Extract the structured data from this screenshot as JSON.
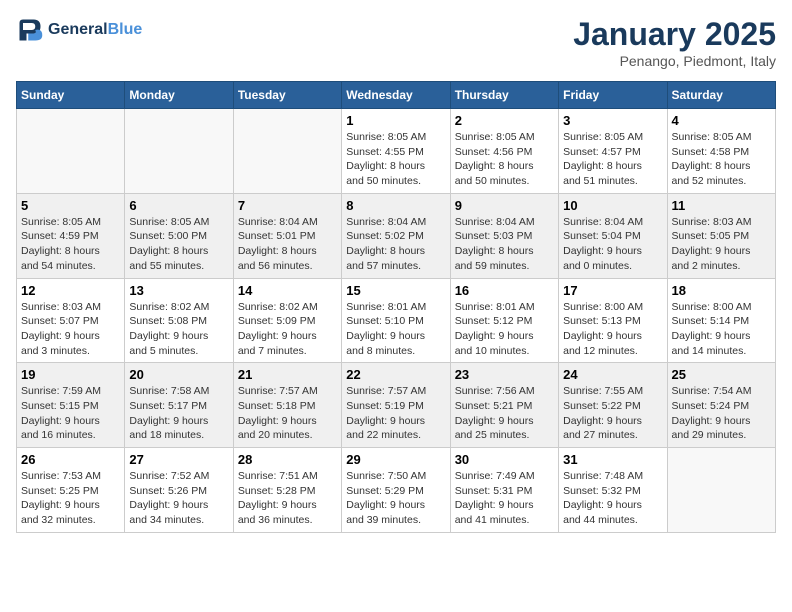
{
  "header": {
    "logo_line1": "General",
    "logo_line2": "Blue",
    "month": "January 2025",
    "location": "Penango, Piedmont, Italy"
  },
  "weekdays": [
    "Sunday",
    "Monday",
    "Tuesday",
    "Wednesday",
    "Thursday",
    "Friday",
    "Saturday"
  ],
  "rows": [
    [
      {
        "day": "",
        "info": ""
      },
      {
        "day": "",
        "info": ""
      },
      {
        "day": "",
        "info": ""
      },
      {
        "day": "1",
        "info": "Sunrise: 8:05 AM\nSunset: 4:55 PM\nDaylight: 8 hours\nand 50 minutes."
      },
      {
        "day": "2",
        "info": "Sunrise: 8:05 AM\nSunset: 4:56 PM\nDaylight: 8 hours\nand 50 minutes."
      },
      {
        "day": "3",
        "info": "Sunrise: 8:05 AM\nSunset: 4:57 PM\nDaylight: 8 hours\nand 51 minutes."
      },
      {
        "day": "4",
        "info": "Sunrise: 8:05 AM\nSunset: 4:58 PM\nDaylight: 8 hours\nand 52 minutes."
      }
    ],
    [
      {
        "day": "5",
        "info": "Sunrise: 8:05 AM\nSunset: 4:59 PM\nDaylight: 8 hours\nand 54 minutes."
      },
      {
        "day": "6",
        "info": "Sunrise: 8:05 AM\nSunset: 5:00 PM\nDaylight: 8 hours\nand 55 minutes."
      },
      {
        "day": "7",
        "info": "Sunrise: 8:04 AM\nSunset: 5:01 PM\nDaylight: 8 hours\nand 56 minutes."
      },
      {
        "day": "8",
        "info": "Sunrise: 8:04 AM\nSunset: 5:02 PM\nDaylight: 8 hours\nand 57 minutes."
      },
      {
        "day": "9",
        "info": "Sunrise: 8:04 AM\nSunset: 5:03 PM\nDaylight: 8 hours\nand 59 minutes."
      },
      {
        "day": "10",
        "info": "Sunrise: 8:04 AM\nSunset: 5:04 PM\nDaylight: 9 hours\nand 0 minutes."
      },
      {
        "day": "11",
        "info": "Sunrise: 8:03 AM\nSunset: 5:05 PM\nDaylight: 9 hours\nand 2 minutes."
      }
    ],
    [
      {
        "day": "12",
        "info": "Sunrise: 8:03 AM\nSunset: 5:07 PM\nDaylight: 9 hours\nand 3 minutes."
      },
      {
        "day": "13",
        "info": "Sunrise: 8:02 AM\nSunset: 5:08 PM\nDaylight: 9 hours\nand 5 minutes."
      },
      {
        "day": "14",
        "info": "Sunrise: 8:02 AM\nSunset: 5:09 PM\nDaylight: 9 hours\nand 7 minutes."
      },
      {
        "day": "15",
        "info": "Sunrise: 8:01 AM\nSunset: 5:10 PM\nDaylight: 9 hours\nand 8 minutes."
      },
      {
        "day": "16",
        "info": "Sunrise: 8:01 AM\nSunset: 5:12 PM\nDaylight: 9 hours\nand 10 minutes."
      },
      {
        "day": "17",
        "info": "Sunrise: 8:00 AM\nSunset: 5:13 PM\nDaylight: 9 hours\nand 12 minutes."
      },
      {
        "day": "18",
        "info": "Sunrise: 8:00 AM\nSunset: 5:14 PM\nDaylight: 9 hours\nand 14 minutes."
      }
    ],
    [
      {
        "day": "19",
        "info": "Sunrise: 7:59 AM\nSunset: 5:15 PM\nDaylight: 9 hours\nand 16 minutes."
      },
      {
        "day": "20",
        "info": "Sunrise: 7:58 AM\nSunset: 5:17 PM\nDaylight: 9 hours\nand 18 minutes."
      },
      {
        "day": "21",
        "info": "Sunrise: 7:57 AM\nSunset: 5:18 PM\nDaylight: 9 hours\nand 20 minutes."
      },
      {
        "day": "22",
        "info": "Sunrise: 7:57 AM\nSunset: 5:19 PM\nDaylight: 9 hours\nand 22 minutes."
      },
      {
        "day": "23",
        "info": "Sunrise: 7:56 AM\nSunset: 5:21 PM\nDaylight: 9 hours\nand 25 minutes."
      },
      {
        "day": "24",
        "info": "Sunrise: 7:55 AM\nSunset: 5:22 PM\nDaylight: 9 hours\nand 27 minutes."
      },
      {
        "day": "25",
        "info": "Sunrise: 7:54 AM\nSunset: 5:24 PM\nDaylight: 9 hours\nand 29 minutes."
      }
    ],
    [
      {
        "day": "26",
        "info": "Sunrise: 7:53 AM\nSunset: 5:25 PM\nDaylight: 9 hours\nand 32 minutes."
      },
      {
        "day": "27",
        "info": "Sunrise: 7:52 AM\nSunset: 5:26 PM\nDaylight: 9 hours\nand 34 minutes."
      },
      {
        "day": "28",
        "info": "Sunrise: 7:51 AM\nSunset: 5:28 PM\nDaylight: 9 hours\nand 36 minutes."
      },
      {
        "day": "29",
        "info": "Sunrise: 7:50 AM\nSunset: 5:29 PM\nDaylight: 9 hours\nand 39 minutes."
      },
      {
        "day": "30",
        "info": "Sunrise: 7:49 AM\nSunset: 5:31 PM\nDaylight: 9 hours\nand 41 minutes."
      },
      {
        "day": "31",
        "info": "Sunrise: 7:48 AM\nSunset: 5:32 PM\nDaylight: 9 hours\nand 44 minutes."
      },
      {
        "day": "",
        "info": ""
      }
    ]
  ]
}
